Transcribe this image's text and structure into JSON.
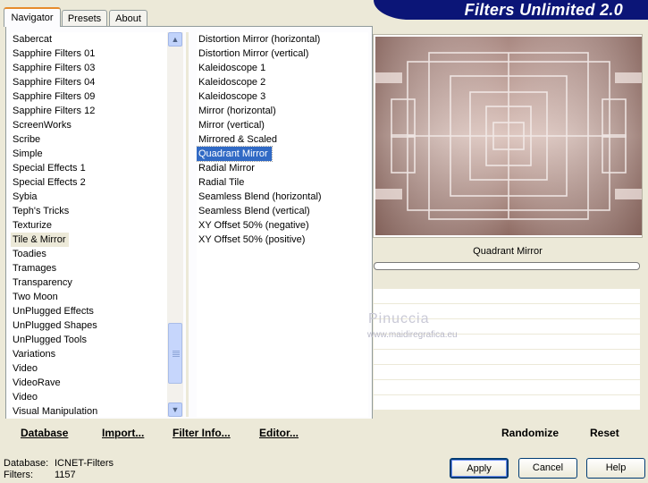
{
  "app": {
    "title": "Filters Unlimited 2.0"
  },
  "tabs": [
    {
      "label": "Navigator",
      "active": true
    },
    {
      "label": "Presets",
      "active": false
    },
    {
      "label": "About",
      "active": false
    }
  ],
  "categories": {
    "items": [
      "Sabercat",
      "Sapphire Filters 01",
      "Sapphire Filters 03",
      "Sapphire Filters 04",
      "Sapphire Filters 09",
      "Sapphire Filters 12",
      "ScreenWorks",
      "Scribe",
      "Simple",
      "Special Effects 1",
      "Special Effects 2",
      "Sybia",
      "Teph's Tricks",
      "Texturize",
      "Tile & Mirror",
      "Toadies",
      "Tramages",
      "Transparency",
      "Two Moon",
      "UnPlugged Effects",
      "UnPlugged Shapes",
      "UnPlugged Tools",
      "Variations",
      "Video",
      "VideoRave",
      "Video",
      "Visual Manipulation"
    ],
    "selected": "Tile & Mirror"
  },
  "filters": {
    "items": [
      "Distortion Mirror (horizontal)",
      "Distortion Mirror (vertical)",
      "Kaleidoscope 1",
      "Kaleidoscope 2",
      "Kaleidoscope 3",
      "Mirror (horizontal)",
      "Mirror (vertical)",
      "Mirrored & Scaled",
      "Quadrant Mirror",
      "Radial Mirror",
      "Radial Tile",
      "Seamless Blend (horizontal)",
      "Seamless Blend (vertical)",
      "XY Offset 50% (negative)",
      "XY Offset 50% (positive)"
    ],
    "selected": "Quadrant Mirror"
  },
  "toolbar": {
    "database_label": "Database",
    "import_label": "Import...",
    "filter_info_label": "Filter Info...",
    "editor_label": "Editor..."
  },
  "preview": {
    "filter_name": "Quadrant Mirror"
  },
  "params": {
    "randomize_label": "Randomize",
    "reset_label": "Reset"
  },
  "watermark": {
    "name": "Pinuccia",
    "site": "www.maidiregrafica.eu"
  },
  "status": {
    "database_label": "Database:",
    "database_value": "ICNET-Filters",
    "filters_label": "Filters:",
    "filters_value": "1157"
  },
  "buttons": {
    "apply_label": "Apply",
    "cancel_label": "Cancel",
    "help_label": "Help"
  },
  "colors": {
    "banner": "#0b1577",
    "selection": "#316ac5",
    "tab_accent": "#e68b2c",
    "preview_tone": "#b89a92"
  }
}
